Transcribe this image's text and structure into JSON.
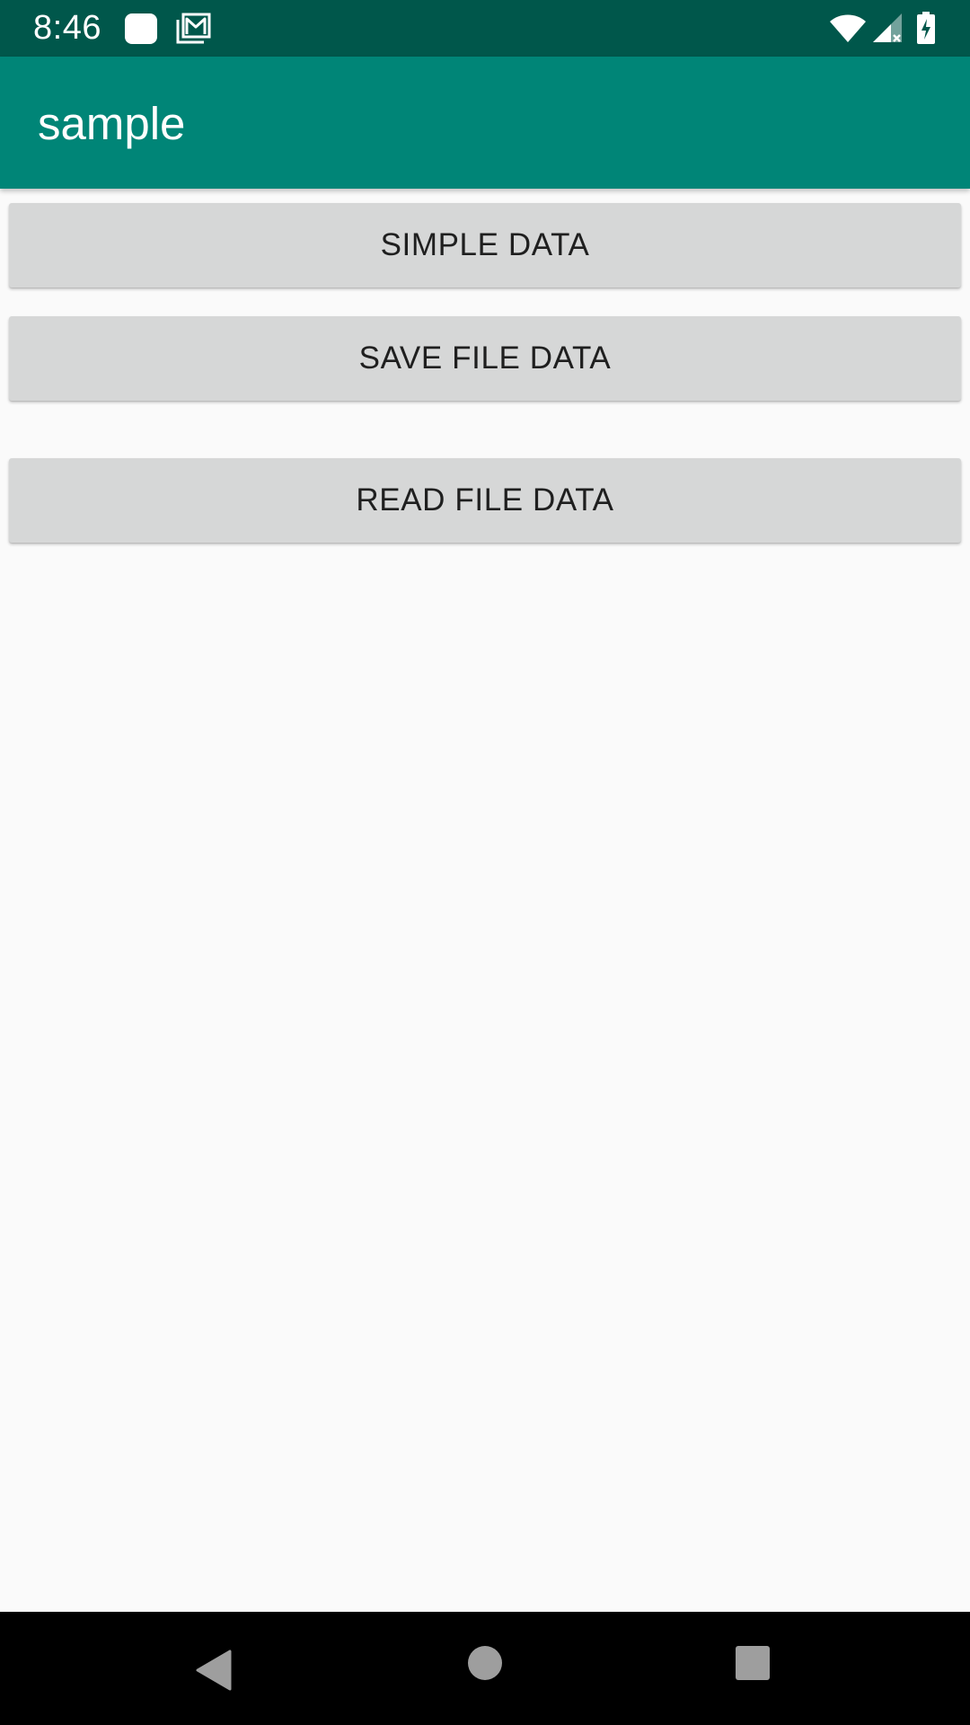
{
  "status_bar": {
    "time": "8:46",
    "icons": [
      "notification-square-icon",
      "photo-message-icon",
      "wifi-icon",
      "cell-signal-icon",
      "battery-charging-icon"
    ]
  },
  "app_bar": {
    "title": "sample"
  },
  "buttons": {
    "simple_data": "SIMPLE DATA",
    "save_file_data": "SAVE FILE DATA",
    "read_file_data": "READ FILE DATA"
  },
  "nav_bar": {
    "icons": [
      "back-icon",
      "home-icon",
      "recents-icon"
    ]
  },
  "colors": {
    "status_bar": "#00574b",
    "app_bar": "#008577",
    "background": "#fafafa",
    "button": "#d6d7d7",
    "button_text": "#1f1f1f"
  }
}
